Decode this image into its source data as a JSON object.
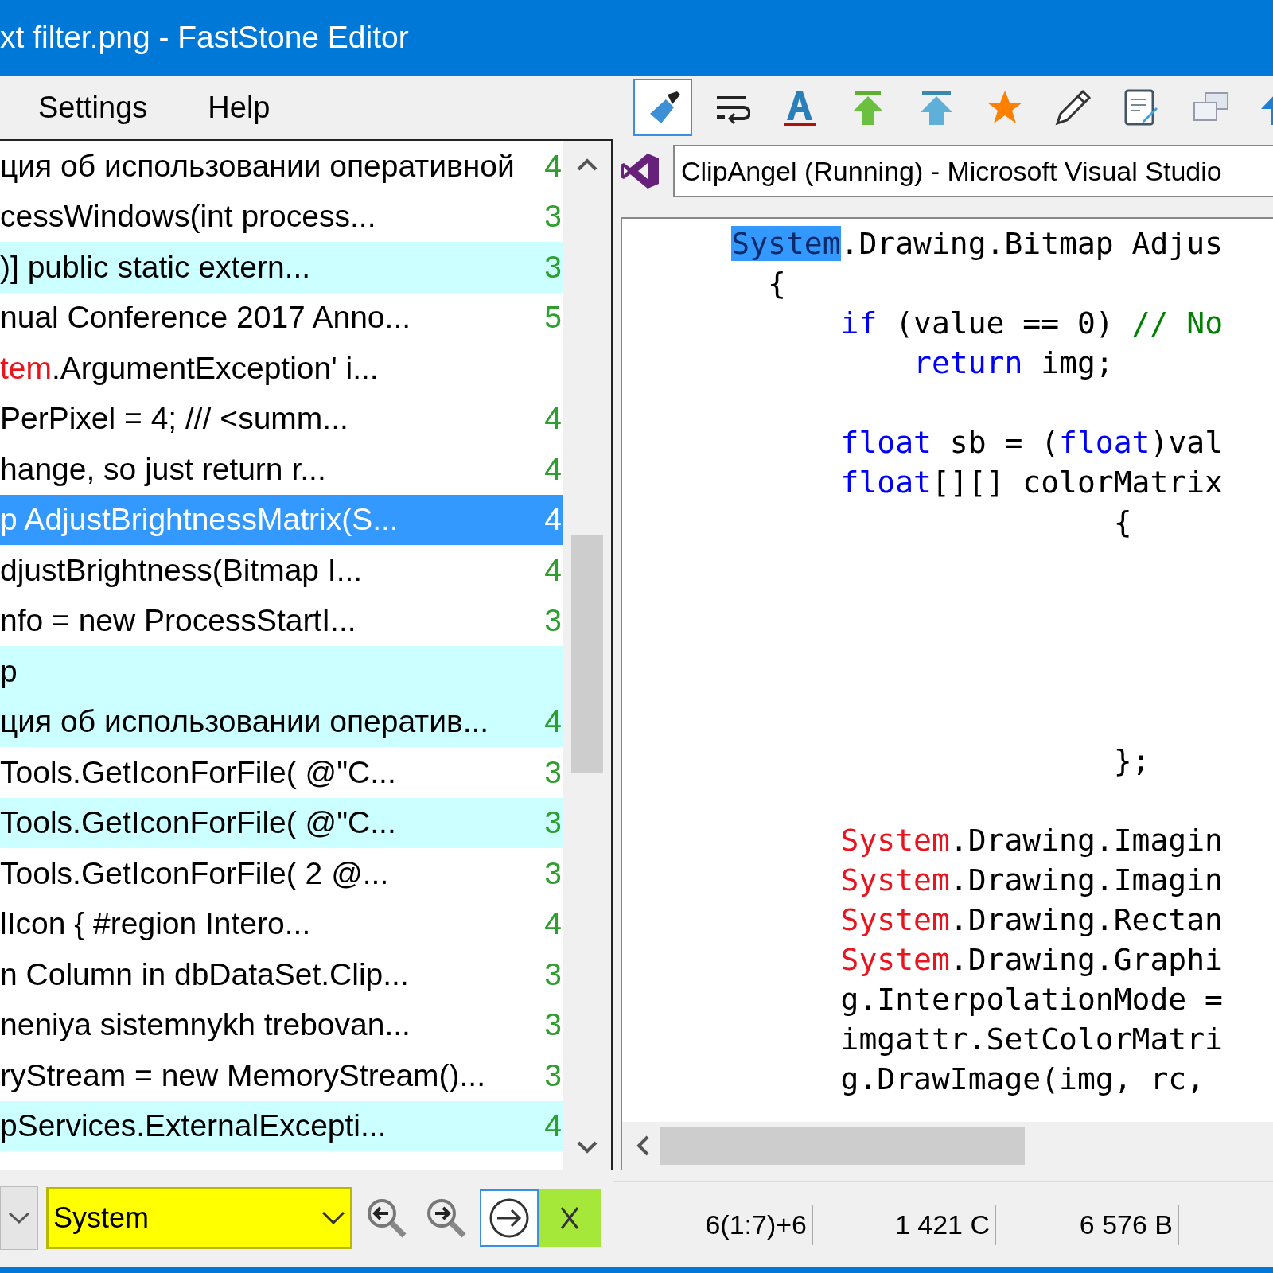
{
  "window": {
    "title": "xt filter.png - FastStone Editor"
  },
  "menu": [
    "Settings",
    "Help"
  ],
  "toolbar": [
    {
      "kind": "brush",
      "pressed": true
    },
    {
      "kind": "wrap",
      "pressed": false
    },
    {
      "kind": "font",
      "pressed": false
    },
    {
      "kind": "top-green",
      "pressed": false
    },
    {
      "kind": "top-blue",
      "pressed": false
    },
    {
      "kind": "star",
      "pressed": false
    },
    {
      "kind": "pencil",
      "pressed": false
    },
    {
      "kind": "note",
      "pressed": false
    },
    {
      "kind": "windows",
      "pressed": false
    },
    {
      "kind": "up",
      "pressed": false
    }
  ],
  "clip_list": [
    {
      "text": "ция об использовании оперативной",
      "count": "4",
      "highlighted": false,
      "selected": false
    },
    {
      "text": "cessWindows(int process...",
      "count": "3",
      "highlighted": false,
      "selected": false
    },
    {
      "text": ")] public static extern...",
      "count": "3",
      "highlighted": true,
      "selected": false
    },
    {
      "text": "nual Conference 2017 Anno...",
      "count": "5",
      "highlighted": false,
      "selected": false
    },
    {
      "match": "tem",
      "text": ".ArgumentException' i...",
      "highlighted": false,
      "selected": false
    },
    {
      "text": "PerPixel = 4; /// <summ...",
      "count": "4",
      "highlighted": false,
      "selected": false
    },
    {
      "text": "hange, so just return r...",
      "count": "4",
      "highlighted": false,
      "selected": false
    },
    {
      "text": "p AdjustBrightnessMatrix(S...",
      "count": "4",
      "selected": true
    },
    {
      "text": "djustBrightness(Bitmap I...",
      "count": "4",
      "highlighted": false,
      "selected": false
    },
    {
      "text": "nfo = new ProcessStartI...",
      "count": "3",
      "highlighted": false,
      "selected": false
    },
    {
      "text": "p",
      "highlighted": true,
      "selected": false
    },
    {
      "text": "ция об использовании оператив...",
      "count": "4",
      "highlighted": true,
      "selected": false
    },
    {
      "text": "Tools.GetIconForFile( @\"C...",
      "count": "3",
      "highlighted": false,
      "selected": false
    },
    {
      "text": "Tools.GetIconForFile( @\"C...",
      "count": "3",
      "highlighted": true,
      "selected": false
    },
    {
      "text": "Tools.GetIconForFile( 2 @...",
      "count": "3",
      "highlighted": false,
      "selected": false
    },
    {
      "text": "lIcon { #region Intero...",
      "count": "4",
      "highlighted": false,
      "selected": false
    },
    {
      "text": "n Column in dbDataSet.Clip...",
      "count": "3",
      "highlighted": false,
      "selected": false
    },
    {
      "text": "neniya sistemnykh trebovan...",
      "count": "3",
      "highlighted": false,
      "selected": false
    },
    {
      "text": "ryStream = new MemoryStream()...",
      "count": "3",
      "highlighted": false,
      "selected": false
    },
    {
      "text": "pServices.ExternalExcepti...",
      "count": "4",
      "highlighted": true,
      "selected": false
    }
  ],
  "search": {
    "value": "System"
  },
  "clip_title": "ClipAngel (Running) - Microsoft Visual Studio",
  "code_lines": [
    {
      "kind": "code",
      "tokens": [
        {
          "kind": "selection",
          "text": "      System"
        },
        {
          "kind": "plain",
          "text": ".Drawing.Bitmap Adjus"
        }
      ]
    },
    {
      "kind": "code",
      "tokens": [
        {
          "kind": "plain",
          "text": "        {"
        }
      ]
    },
    {
      "kind": "code",
      "tokens": [
        {
          "kind": "keyword",
          "text": "            if"
        },
        {
          "kind": "plain",
          "text": " (value == 0) "
        },
        {
          "kind": "comment",
          "text": "// No"
        }
      ]
    },
    {
      "kind": "code",
      "tokens": [
        {
          "kind": "keyword",
          "text": "                return"
        },
        {
          "kind": "plain",
          "text": " img;"
        }
      ]
    },
    {
      "kind": "blank"
    },
    {
      "kind": "code",
      "tokens": [
        {
          "kind": "keyword",
          "text": "            float"
        },
        {
          "kind": "plain",
          "text": " sb = ("
        },
        {
          "kind": "keyword",
          "text": "float"
        },
        {
          "kind": "plain",
          "text": ")val"
        }
      ]
    },
    {
      "kind": "code",
      "tokens": [
        {
          "kind": "keyword",
          "text": "            float"
        },
        {
          "kind": "plain",
          "text": "[][] colorMatrix"
        }
      ]
    },
    {
      "kind": "code",
      "tokens": [
        {
          "kind": "plain",
          "text": "                           {"
        }
      ]
    },
    {
      "kind": "blank"
    },
    {
      "kind": "blank"
    },
    {
      "kind": "blank"
    },
    {
      "kind": "blank"
    },
    {
      "kind": "blank"
    },
    {
      "kind": "code",
      "tokens": [
        {
          "kind": "plain",
          "text": "                           };"
        }
      ]
    },
    {
      "kind": "blank"
    },
    {
      "kind": "code",
      "tokens": [
        {
          "kind": "match",
          "text": "            System"
        },
        {
          "kind": "plain",
          "text": ".Drawing.Imagin"
        }
      ]
    },
    {
      "kind": "code",
      "tokens": [
        {
          "kind": "match",
          "text": "            System"
        },
        {
          "kind": "plain",
          "text": ".Drawing.Imagin"
        }
      ]
    },
    {
      "kind": "code",
      "tokens": [
        {
          "kind": "match",
          "text": "            System"
        },
        {
          "kind": "plain",
          "text": ".Drawing.Rectan"
        }
      ]
    },
    {
      "kind": "code",
      "tokens": [
        {
          "kind": "match",
          "text": "            System"
        },
        {
          "kind": "plain",
          "text": ".Drawing.Graphi"
        }
      ]
    },
    {
      "kind": "code",
      "tokens": [
        {
          "kind": "plain",
          "text": "            g.InterpolationMode ="
        }
      ]
    },
    {
      "kind": "code",
      "tokens": [
        {
          "kind": "plain",
          "text": "            imgattr.SetColorMatri"
        }
      ]
    },
    {
      "kind": "code",
      "tokens": [
        {
          "kind": "plain",
          "text": "            g.DrawImage(img, rc, "
        }
      ]
    }
  ],
  "status_bar": [
    "6(1:7)+6",
    "1 421 C",
    "6 576 B"
  ]
}
